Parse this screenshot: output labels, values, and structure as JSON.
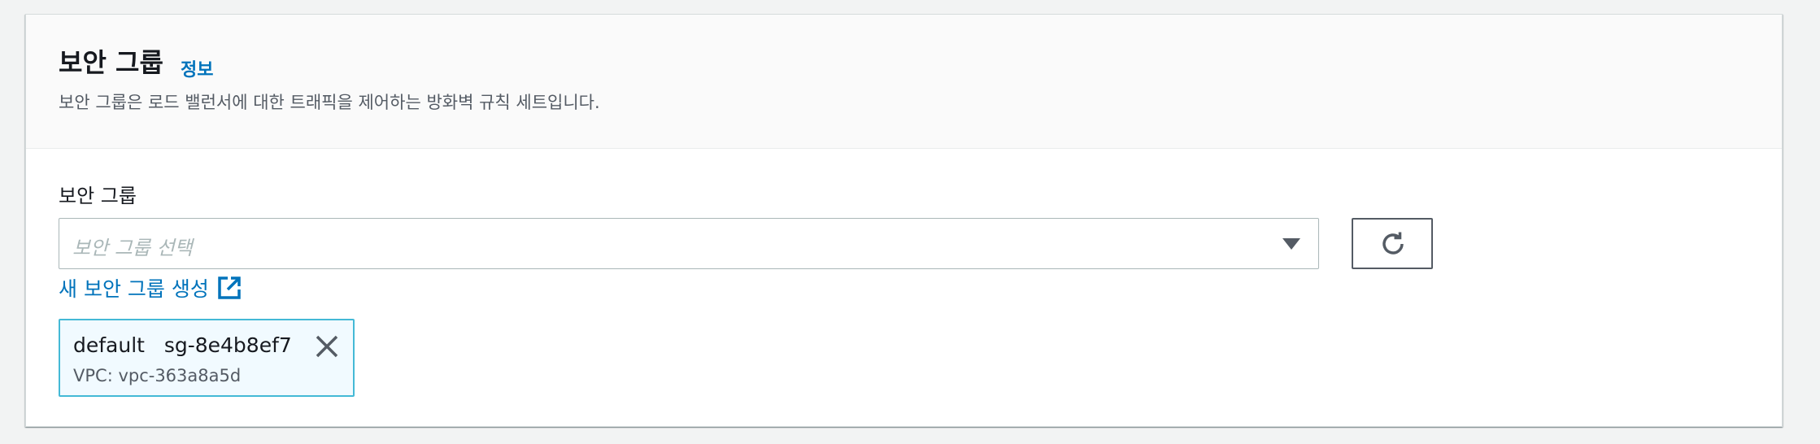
{
  "header": {
    "title": "보안 그룹",
    "info_link": "정보",
    "description": "보안 그룹은 로드 밸런서에 대한 트래픽을 제어하는 방화벽 규칙 세트입니다."
  },
  "field": {
    "label": "보안 그룹",
    "placeholder": "보안 그룹 선택"
  },
  "actions": {
    "refresh_icon": "refresh-icon",
    "create_link": "새 보안 그룹 생성",
    "create_link_icon": "external-link-icon"
  },
  "selected_token": {
    "name": "default",
    "id": "sg-8e4b8ef7",
    "vpc": "VPC: vpc-363a8a5d",
    "close_icon": "close-icon"
  },
  "colors": {
    "link": "#0073bb",
    "token_bg": "#f1faff",
    "token_border": "#44b9d6"
  }
}
